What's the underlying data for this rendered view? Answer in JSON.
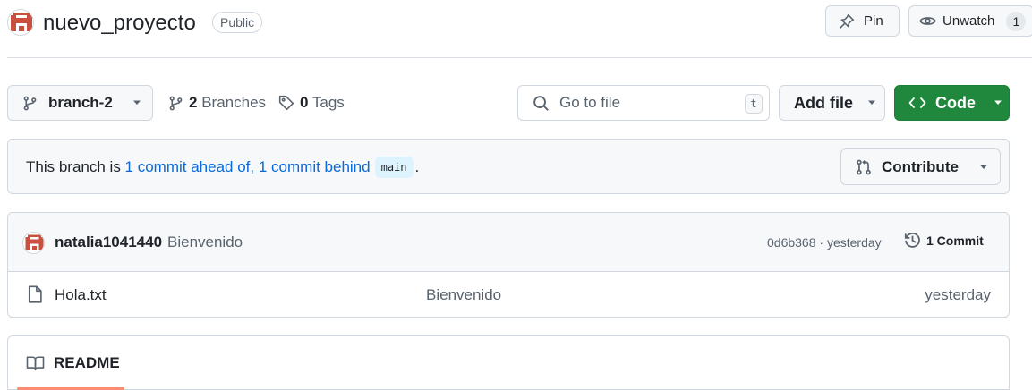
{
  "repo": {
    "name": "nuevo_proyecto",
    "visibility": "Public"
  },
  "header": {
    "pin_label": "Pin",
    "watch_label": "Unwatch",
    "watch_count": "1"
  },
  "toolbar": {
    "branch_name": "branch-2",
    "branches_count": "2",
    "branches_label": "Branches",
    "tags_count": "0",
    "tags_label": "Tags",
    "goto_placeholder": "Go to file",
    "goto_shortcut": "t",
    "add_file_label": "Add file",
    "code_label": "Code"
  },
  "branch_status": {
    "prefix": "This branch is ",
    "ahead_text": "1 commit ahead of,",
    "behind_text": "1 commit behind",
    "base_branch": "main",
    "suffix": ".",
    "contribute_label": "Contribute"
  },
  "latest_commit": {
    "author": "natalia1041440",
    "message": "Bienvenido",
    "hash_and_time": "0d6b368 · yesterday",
    "commits_label": "1 Commit"
  },
  "files": [
    {
      "name": "Hola.txt",
      "commit_message": "Bienvenido",
      "date": "yesterday"
    }
  ],
  "readme": {
    "tab_label": "README"
  },
  "colors": {
    "accent_link": "#0969da",
    "code_button": "#1f883d",
    "tab_underline": "#fd8c73",
    "avatar": "#c9503f"
  }
}
